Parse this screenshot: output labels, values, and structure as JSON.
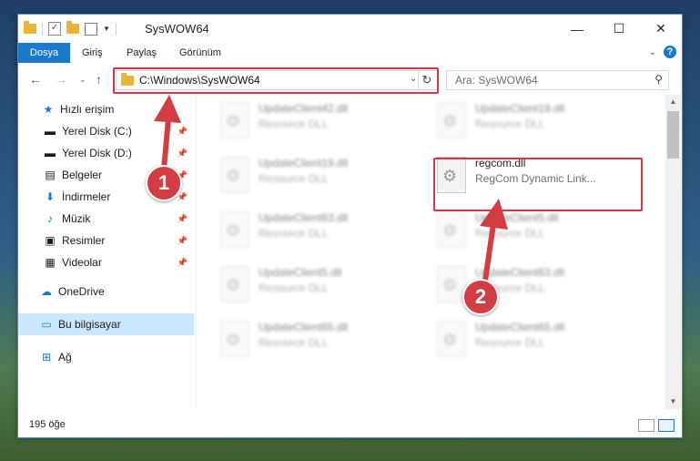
{
  "window": {
    "title": "SysWOW64",
    "controls": {
      "minimize": "—",
      "maximize": "☐",
      "close": "✕"
    }
  },
  "ribbon": {
    "tabs": [
      "Dosya",
      "Giriş",
      "Paylaş",
      "Görünüm"
    ],
    "accent": "#1979ca"
  },
  "address": {
    "path": "C:\\Windows\\SysWOW64",
    "search_placeholder": "Ara: SysWOW64"
  },
  "nav": {
    "quick_access": "Hızlı erişim",
    "items": [
      {
        "label": "Yerel Disk (C:)",
        "icon": "drive-icon",
        "pinned": true
      },
      {
        "label": "Yerel Disk (D:)",
        "icon": "drive-icon",
        "pinned": true
      },
      {
        "label": "Belgeler",
        "icon": "documents-icon",
        "pinned": true
      },
      {
        "label": "İndirmeler",
        "icon": "download-icon",
        "pinned": true
      },
      {
        "label": "Müzik",
        "icon": "music-icon",
        "pinned": true
      },
      {
        "label": "Resimler",
        "icon": "pictures-icon",
        "pinned": true
      },
      {
        "label": "Videolar",
        "icon": "video-icon",
        "pinned": true
      }
    ],
    "onedrive": "OneDrive",
    "this_pc": "Bu bilgisayar",
    "network": "Ağ"
  },
  "files": [
    {
      "name": "UpdateClient42.dll",
      "desc": "Resource DLL",
      "blurred": true
    },
    {
      "name": "UpdateClient19.dll",
      "desc": "Resource DLL",
      "blurred": true
    },
    {
      "name": "UpdateClient19.dll",
      "desc": "Resource DLL",
      "blurred": true
    },
    {
      "name": "regcom.dll",
      "desc": "RegCom Dynamic Link...",
      "blurred": false
    },
    {
      "name": "UpdateClient63.dll",
      "desc": "Resource DLL",
      "blurred": true
    },
    {
      "name": "UpdateClient5.dll",
      "desc": "Resource DLL",
      "blurred": true
    },
    {
      "name": "UpdateClient5.dll",
      "desc": "Resource DLL",
      "blurred": true
    },
    {
      "name": "UpdateClient63.dll",
      "desc": "Resource DLL",
      "blurred": true
    },
    {
      "name": "UpdateClient65.dll",
      "desc": "Resource DLL",
      "blurred": true
    },
    {
      "name": "UpdateClient65.dll",
      "desc": "Resource DLL",
      "blurred": true
    }
  ],
  "status": {
    "count": "195 öğe"
  },
  "callouts": {
    "one": "1",
    "two": "2",
    "color": "#d23d43"
  }
}
